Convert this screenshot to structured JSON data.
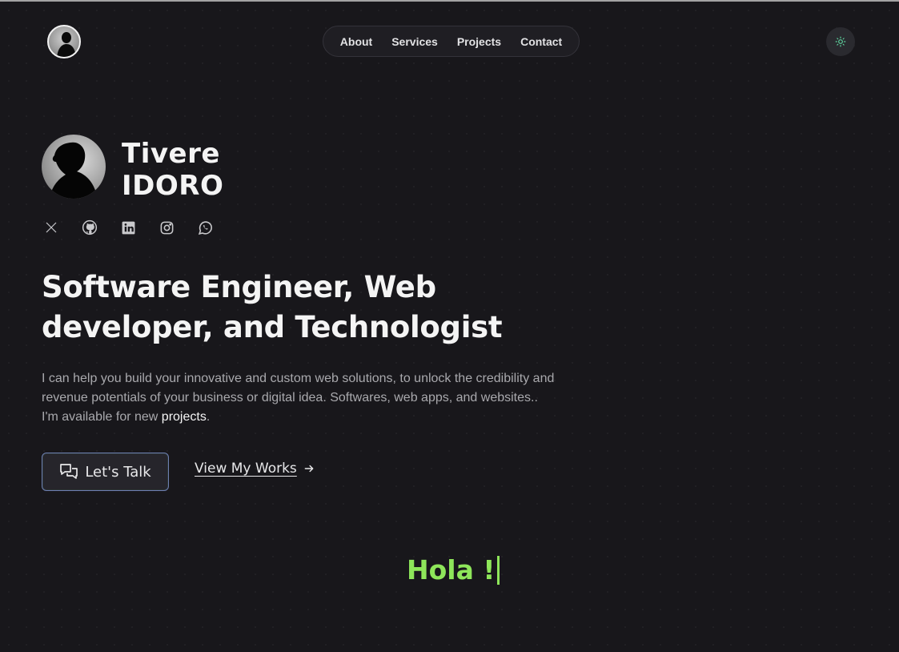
{
  "header": {
    "nav": [
      "About",
      "Services",
      "Projects",
      "Contact"
    ]
  },
  "hero": {
    "name_first": "Tivere",
    "name_last": "IDORO",
    "socials": [
      "x-icon",
      "github-icon",
      "linkedin-icon",
      "instagram-icon",
      "whatsapp-icon"
    ],
    "headline_line1": "Software Engineer, Web",
    "headline_line2": "developer, and Technologist",
    "desc_line1": "I can help you build your innovative and custom web solutions, to unlock the credibility and",
    "desc_line2": "revenue potentials of your business or digital idea. Softwares, web apps, and websites..",
    "desc_line3_prefix": "I'm available for new ",
    "desc_link": "projects",
    "desc_suffix": ".",
    "cta_label": "Let's Talk",
    "works_label": "View My Works",
    "greeting": "Hola !"
  },
  "colors": {
    "background": "#18171b",
    "accent_green": "#8ee65a"
  }
}
